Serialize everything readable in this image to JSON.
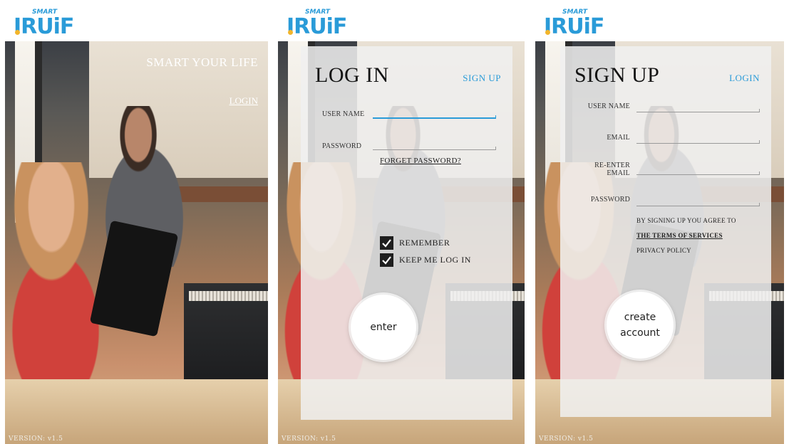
{
  "logo": {
    "tag": "SMART",
    "word": "IRUiF"
  },
  "version": "VERSION: v1.5",
  "landing": {
    "tagline": "SMART YOUR LIFE",
    "login_link": "LOGIN"
  },
  "login_form": {
    "title": "LOG IN",
    "switch_link": "SIGN UP",
    "username_label": "USER NAME",
    "password_label": "PASSWORD",
    "forgot_link": "FORGET PASSWORD?",
    "remember_label": "REMEMBER",
    "remember_checked": true,
    "keep_label": "KEEP ME LOG IN",
    "keep_checked": true,
    "submit_label": "enter"
  },
  "signup_form": {
    "title": "SIGN UP",
    "switch_link": "LOGIN",
    "username_label": "USER NAME",
    "email_label": "EMAIL",
    "reenter_label_1": "RE-ENTER",
    "reenter_label_2": "EMAIL",
    "password_label": "PASSWORD",
    "agree_text": "BY SIGNING UP YOU AGREE TO",
    "terms_link": "THE TERMS OF SERVICES",
    "privacy_text": "PRIVACY POLICY",
    "submit_line_1": "create",
    "submit_line_2": "account"
  },
  "colors": {
    "accent": "#2a9bd8",
    "checkbox": "#1e1e1e"
  }
}
